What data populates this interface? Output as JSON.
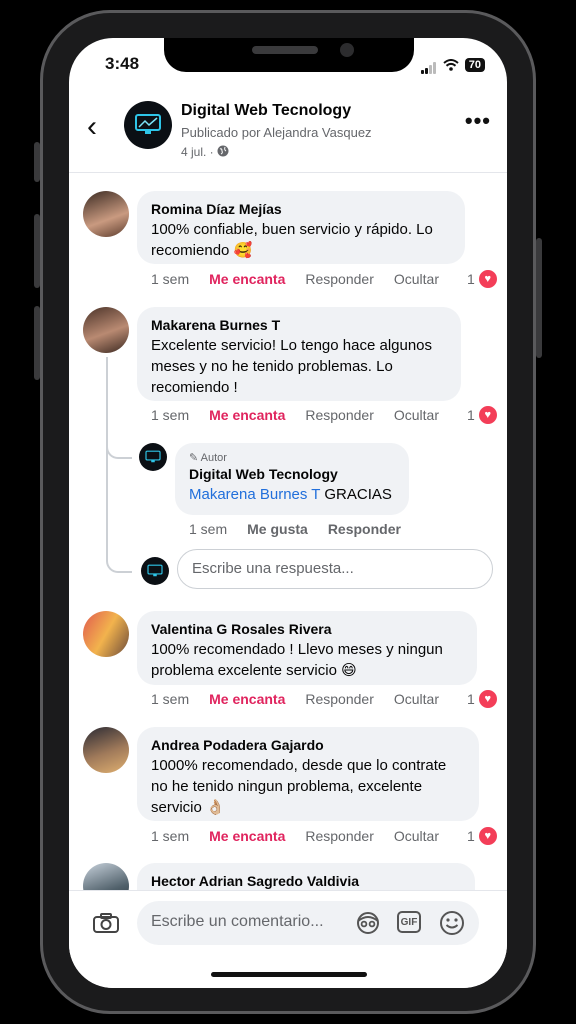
{
  "status": {
    "time": "3:48",
    "battery": "70"
  },
  "header": {
    "page_name": "Digital Web Tecnology",
    "posted_by": "Publicado por Alejandra Vasquez",
    "date": "4 jul. ·"
  },
  "comments": [
    {
      "author": "Romina Díaz Mejías",
      "text": "100% confiable, buen servicio y rápido. Lo recomiendo 🥰",
      "time": "1 sem",
      "reaction_label": "Me encanta",
      "reply_label": "Responder",
      "hide_label": "Ocultar",
      "reaction_count": "1"
    },
    {
      "author": "Makarena Burnes T",
      "text": "Excelente servicio! Lo tengo hace algunos meses y no he tenido problemas. Lo recomiendo !",
      "time": "1 sem",
      "reaction_label": "Me encanta",
      "reply_label": "Responder",
      "hide_label": "Ocultar",
      "reaction_count": "1",
      "reply": {
        "badge": "Autor",
        "author": "Digital Web Tecnology",
        "mention": "Makarena Burnes T",
        "text": " GRACIAS",
        "time": "1 sem",
        "like_label": "Me gusta",
        "reply_label": "Responder"
      },
      "reply_placeholder": "Escribe una respuesta..."
    },
    {
      "author": "Valentina G Rosales Rivera",
      "text": "100% recomendado ! Llevo meses  y ningun problema excelente servicio 😄",
      "time": "1 sem",
      "reaction_label": "Me encanta",
      "reply_label": "Responder",
      "hide_label": "Ocultar",
      "reaction_count": "1"
    },
    {
      "author": "Andrea Podadera Gajardo",
      "text": "1000% recomendado, desde que lo contrate no he tenido ningun problema, excelente servicio 👌🏼",
      "time": "1 sem",
      "reaction_label": "Me encanta",
      "reply_label": "Responder",
      "hide_label": "Ocultar",
      "reaction_count": "1"
    },
    {
      "author": "Hector Adrian Sagredo Valdivia"
    }
  ],
  "footer": {
    "placeholder": "Escribe un comentario...",
    "gif_label": "GIF"
  },
  "colors": {
    "love": "#e0245e",
    "link": "#216fdb",
    "bubble": "#f0f2f5",
    "heart": "#f33e58"
  }
}
